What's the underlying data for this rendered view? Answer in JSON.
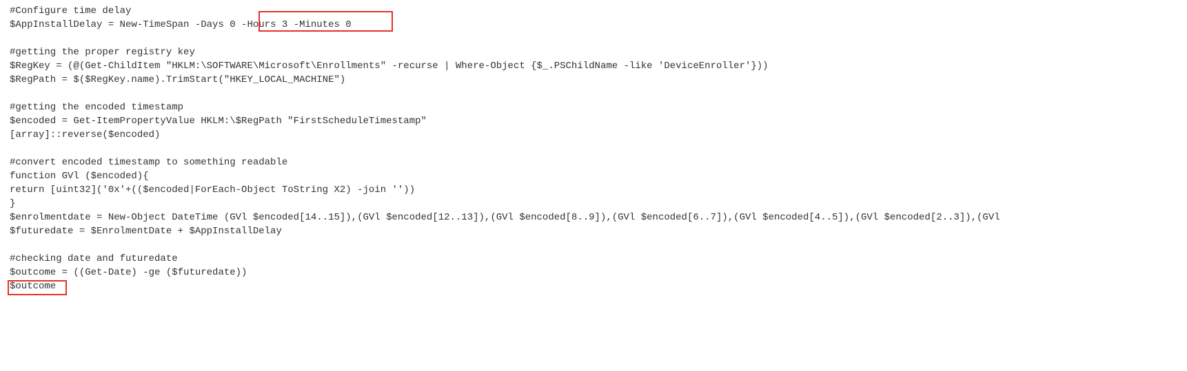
{
  "code": {
    "l1": "#Configure time delay",
    "l2a": "$AppInstallDelay = New-TimeSpan -Days 0",
    "l2b": " -Hours 3 -Minutes 0",
    "l3": "#getting the proper registry key",
    "l4": "$RegKey = (@(Get-ChildItem \"HKLM:\\SOFTWARE\\Microsoft\\Enrollments\" -recurse | Where-Object {$_.PSChildName -like 'DeviceEnroller'}))",
    "l5": "$RegPath = $($RegKey.name).TrimStart(\"HKEY_LOCAL_MACHINE\")",
    "l6": "#getting the encoded timestamp",
    "l7": "$encoded = Get-ItemPropertyValue HKLM:\\$RegPath \"FirstScheduleTimestamp\"",
    "l8": "[array]::reverse($encoded)",
    "l9": "#convert encoded timestamp to something readable",
    "l10": "function GVl ($encoded){",
    "l11": "return [uint32]('0x'+(($encoded|ForEach-Object ToString X2) -join ''))",
    "l12": "}",
    "l13": "$enrolmentdate = New-Object DateTime (GVl $encoded[14..15]),(GVl $encoded[12..13]),(GVl $encoded[8..9]),(GVl $encoded[6..7]),(GVl $encoded[4..5]),(GVl $encoded[2..3]),(GVl",
    "l14": "$futuredate = $EnrolmentDate + $AppInstallDelay",
    "l15": "#checking date and futuredate",
    "l16": "$outcome = ((Get-Date) -ge ($futuredate))",
    "l17": "$outcome"
  }
}
